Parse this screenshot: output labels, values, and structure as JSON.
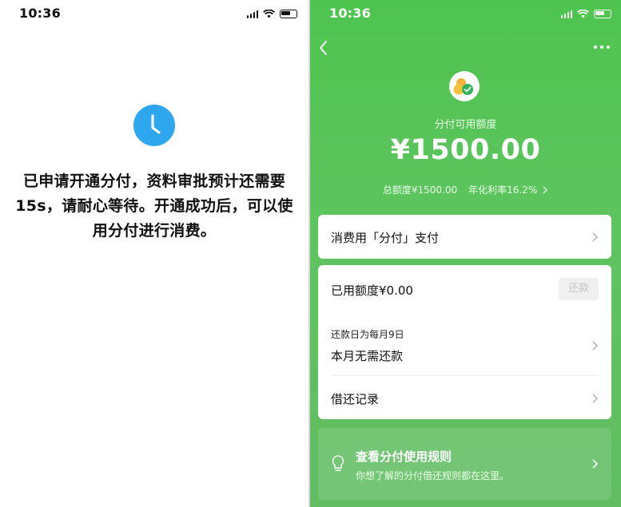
{
  "left_screen": {
    "status_time": "10:36",
    "message": "已申请开通分付，资料审批预计还需要15s，请耐心等待。开通成功后，可以使用分付进行消费。"
  },
  "right_screen": {
    "status_time": "10:36",
    "credit_label": "分付可用额度",
    "credit_amount": "¥1500.00",
    "total_limit": "总额度¥1500.00",
    "annual_rate": "年化利率16.2%",
    "pay_with_label": "消费用「分付」支付",
    "used_limit": "已用额度¥0.00",
    "repay_button": "还款",
    "repay_day_label": "还款日为每月9日",
    "repay_status": "本月无需还款",
    "records_label": "借还记录",
    "rules_title": "查看分付使用规则",
    "rules_desc": "你想了解的分付借还规则都在这里。"
  },
  "colors": {
    "accent_blue": "#2ea7ee",
    "green_bg": "#55c456",
    "white": "#ffffff"
  },
  "icons": [
    "clock-icon",
    "signal-icon",
    "wifi-icon",
    "battery-icon",
    "back-icon",
    "more-icon",
    "fenfu-logo-icon",
    "chevron-right-icon",
    "lightbulb-icon"
  ]
}
